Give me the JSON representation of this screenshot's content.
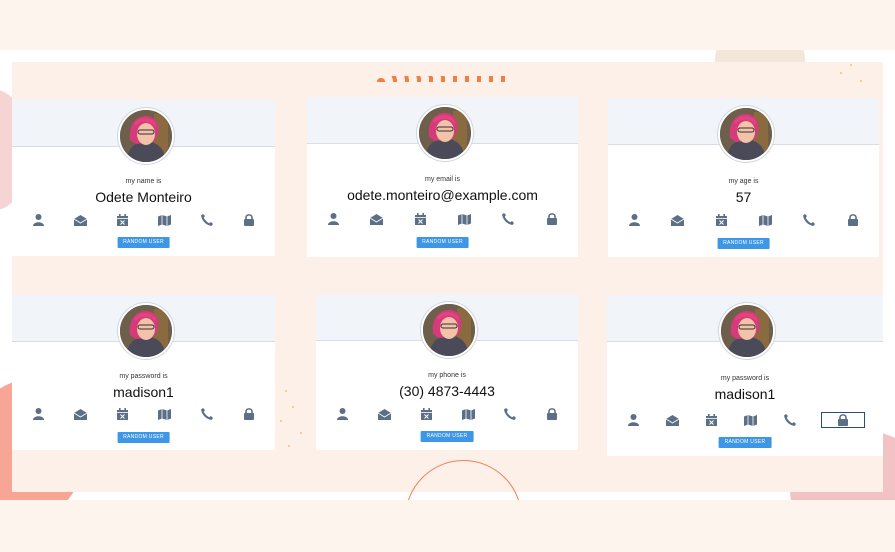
{
  "cards": [
    {
      "label": "my name is",
      "value": "Odete Monteiro",
      "button": "RANDOM USER"
    },
    {
      "label": "my email is",
      "value": "odete.monteiro@example.com",
      "button": "RANDOM USER"
    },
    {
      "label": "my age is",
      "value": "57",
      "button": "RANDOM USER"
    },
    {
      "label": "my password is",
      "value": "madison1",
      "button": "RANDOM USER"
    },
    {
      "label": "my phone is",
      "value": "(30) 4873-4443",
      "button": "RANDOM USER"
    },
    {
      "label": "my password is",
      "value": "madison1",
      "button": "RANDOM USER"
    }
  ],
  "icons": [
    "user-icon",
    "envelope-icon",
    "calendar-icon",
    "map-icon",
    "phone-icon",
    "lock-icon"
  ],
  "colors": {
    "icon": "#5b6f87",
    "button": "#3d97e6",
    "background": "#fdf0e8"
  }
}
